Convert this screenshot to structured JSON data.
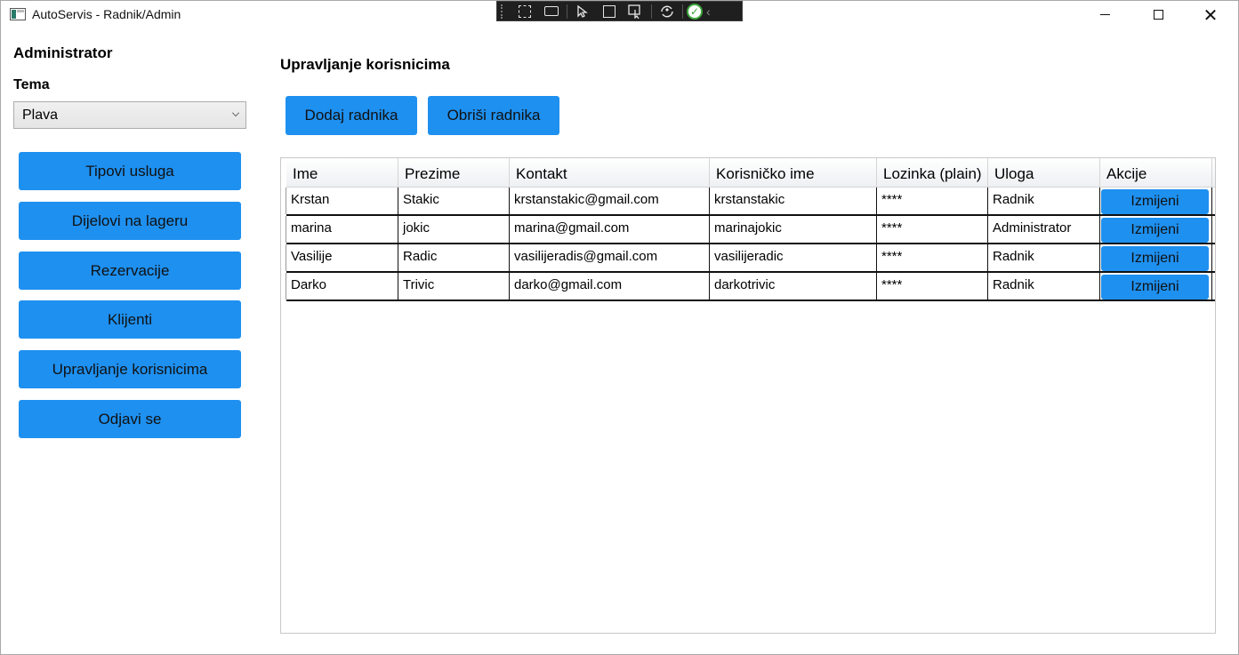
{
  "window": {
    "title": "AutoServis - Radnik/Admin",
    "close_glyph": "✕"
  },
  "debug_toolbar": {
    "icons": [
      "select-element-icon",
      "record-icon",
      "pointer-icon",
      "frame-icon",
      "track-focus-icon",
      "hot-reload-icon",
      "check-icon",
      "collapse-chevron-icon"
    ],
    "check_glyph": "✓",
    "chevron_glyph": "‹"
  },
  "sidebar": {
    "role_label": "Administrator",
    "theme_label": "Tema",
    "theme_value": "Plava",
    "items": [
      {
        "label": "Tipovi usluga"
      },
      {
        "label": "Dijelovi na lageru"
      },
      {
        "label": "Rezervacije"
      },
      {
        "label": "Klijenti"
      },
      {
        "label": "Upravljanje korisnicima"
      },
      {
        "label": "Odjavi se"
      }
    ]
  },
  "main": {
    "title": "Upravljanje korisnicima",
    "add_label": "Dodaj radnika",
    "delete_label": "Obriši radnika",
    "columns": [
      "Ime",
      "Prezime",
      "Kontakt",
      "Korisničko ime",
      "Lozinka (plain)",
      "Uloga",
      "Akcije"
    ],
    "rows": [
      {
        "ime": "Krstan",
        "prezime": "Stakic",
        "kontakt": "krstanstakic@gmail.com",
        "korisnicko": "krstanstakic",
        "lozinka": "****",
        "uloga": "Radnik",
        "akcija": "Izmijeni"
      },
      {
        "ime": "marina",
        "prezime": "jokic",
        "kontakt": "marina@gmail.com",
        "korisnicko": "marinajokic",
        "lozinka": "****",
        "uloga": "Administrator",
        "akcija": "Izmijeni"
      },
      {
        "ime": "Vasilije",
        "prezime": "Radic",
        "kontakt": "vasilijeradis@gmail.com",
        "korisnicko": "vasilijeradic",
        "lozinka": "****",
        "uloga": "Radnik",
        "akcija": "Izmijeni"
      },
      {
        "ime": "Darko",
        "prezime": "Trivic",
        "kontakt": "darko@gmail.com",
        "korisnicko": "darkotrivic",
        "lozinka": "****",
        "uloga": "Radnik",
        "akcija": "Izmijeni"
      }
    ]
  },
  "colors": {
    "accent": "#1e90f0",
    "row_border": "#111111"
  }
}
